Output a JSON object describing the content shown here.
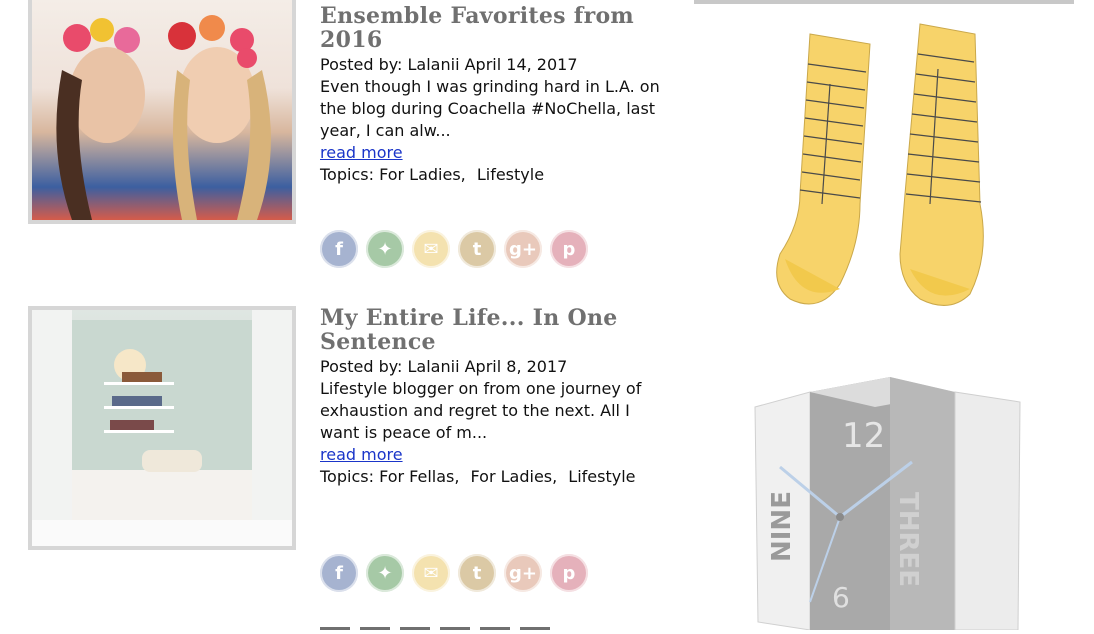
{
  "posts": [
    {
      "title": "Ensemble Favorites from 2016",
      "posted_by_label": "Posted by:",
      "author": "Lalanii",
      "date": "April 14, 2017",
      "excerpt": "Even though I was grinding hard in L.A. on the blog during Coachella #NoChella, last year, I can alw...",
      "read_more": "read more",
      "topics_label": "Topics:",
      "topics": [
        "For Ladies,",
        "Lifestyle"
      ]
    },
    {
      "title": "My Entire Life... In One Sentence",
      "posted_by_label": "Posted by:",
      "author": "Lalanii",
      "date": "April 8, 2017",
      "excerpt": "Lifestyle blogger on from one journey of exhaustion and regret to the next. All I want is peace of m...",
      "read_more": "read more",
      "topics_label": "Topics:",
      "topics": [
        "For Fellas,",
        "For Ladies,",
        "Lifestyle"
      ]
    }
  ],
  "share_icons": [
    {
      "name": "facebook-icon",
      "glyph": "f",
      "color": "#3b5998"
    },
    {
      "name": "twitter-icon",
      "glyph": "✦",
      "color": "#3c8a3c"
    },
    {
      "name": "email-icon",
      "glyph": "✉",
      "color": "#e8c050"
    },
    {
      "name": "tumblr-icon",
      "glyph": "t",
      "color": "#b08a3a"
    },
    {
      "name": "google-plus-icon",
      "glyph": "g+",
      "color": "#d08a6a"
    },
    {
      "name": "pinterest-icon",
      "glyph": "p",
      "color": "#c7556a"
    }
  ],
  "sidebar": {
    "clock_numbers": [
      "12",
      "NINE",
      "THREE",
      "6"
    ]
  }
}
